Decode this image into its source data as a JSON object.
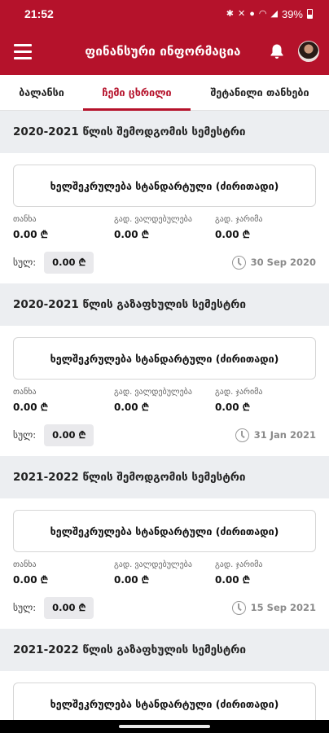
{
  "status_bar": {
    "time": "21:52",
    "battery": "39%"
  },
  "app_bar": {
    "title": "ფინანსური ინფორმაცია"
  },
  "tabs": [
    {
      "label": "ბალანსი",
      "active": false
    },
    {
      "label": "ჩემი ცხრილი",
      "active": true
    },
    {
      "label": "შეტანილი თანხები",
      "active": false
    }
  ],
  "labels": {
    "amount": "თანხა",
    "discount": "გად. ვალდებულება",
    "penalty": "გად. ჯარიმა",
    "due": "სულ:"
  },
  "semesters": [
    {
      "title": "2020-2021 წლის შემოდგომის სემესტრი",
      "contract": "ხელშეკრულება სტანდარტული (ძირითადი)",
      "amount": "0.00 ₾",
      "discount": "0.00 ₾",
      "penalty": "0.00 ₾",
      "total": "0.00 ₾",
      "date": "30 Sep 2020"
    },
    {
      "title": "2020-2021 წლის გაზაფხულის სემესტრი",
      "contract": "ხელშეკრულება სტანდარტული (ძირითადი)",
      "amount": "0.00 ₾",
      "discount": "0.00 ₾",
      "penalty": "0.00 ₾",
      "total": "0.00 ₾",
      "date": "31 Jan 2021"
    },
    {
      "title": "2021-2022 წლის შემოდგომის სემესტრი",
      "contract": "ხელშეკრულება სტანდარტული (ძირითადი)",
      "amount": "0.00 ₾",
      "discount": "0.00 ₾",
      "penalty": "0.00 ₾",
      "total": "0.00 ₾",
      "date": "15 Sep 2021"
    },
    {
      "title": "2021-2022 წლის გაზაფხულის სემესტრი",
      "contract": "ხელშეკრულება სტანდარტული (ძირითადი)"
    }
  ]
}
